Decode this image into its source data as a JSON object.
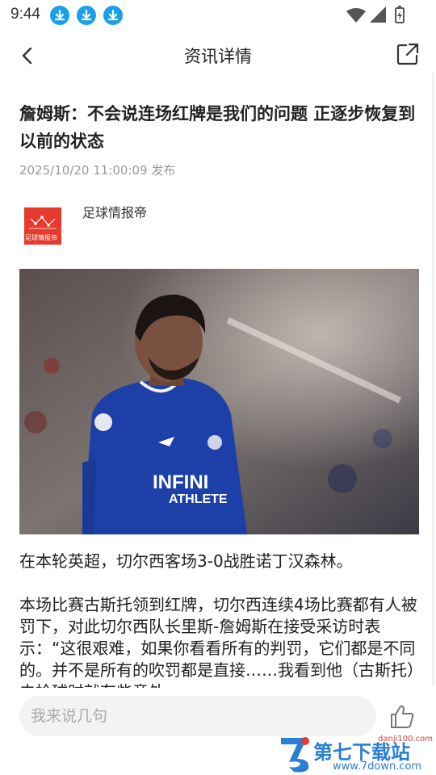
{
  "status_bar": {
    "time": "9:44",
    "download_icons": [
      "download-icon",
      "download-icon",
      "download-icon"
    ],
    "system_icons": [
      "wifi-icon",
      "signal-icon",
      "battery-icon"
    ]
  },
  "nav": {
    "title": "资讯详情",
    "back_icon": "chevron-left-icon",
    "share_icon": "share-icon"
  },
  "article": {
    "title": "詹姆斯：不会说连场红牌是我们的问题 正逐步恢复到以前的状态",
    "publish_time": "2025/10/20 11:00:09 发布",
    "source": {
      "name": "足球情报帝",
      "logo_text": "足球情报帝"
    },
    "paragraphs": [
      "在本轮英超，切尔西客场3-0战胜诺丁汉森林。",
      "本场比赛古斯托领到红牌，切尔西连续4场比赛都有人被罚下，对此切尔西队长里斯-詹姆斯在接受采访时表示：“这很艰难，如果你看看所有的判罚，它们都是不同的。并不是所有的吹罚都是直接……我看到他（古斯托）去抢球时就有些意外"
    ]
  },
  "bottom_bar": {
    "comment_placeholder": "我来说几句",
    "like_icon": "thumbs-up-icon"
  },
  "watermark": {
    "text": "第七下载站",
    "url": "www.7down.com",
    "small": "danji100.com"
  },
  "colors": {
    "accent_blue": "#1aa0ea",
    "logo_red": "#e53a2c",
    "chelsea_blue": "#1c3fa8"
  }
}
